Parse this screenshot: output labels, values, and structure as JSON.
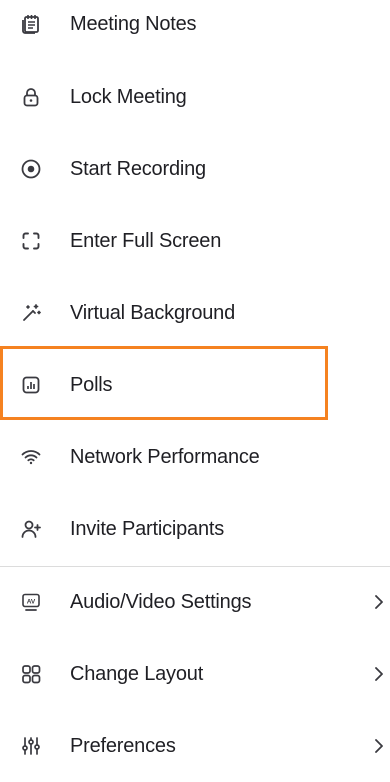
{
  "menu": {
    "items": [
      {
        "label": "Meeting Notes",
        "icon": "notes-icon"
      },
      {
        "label": "Lock Meeting",
        "icon": "lock-icon"
      },
      {
        "label": "Start Recording",
        "icon": "record-icon"
      },
      {
        "label": "Enter Full Screen",
        "icon": "fullscreen-icon"
      },
      {
        "label": "Virtual Background",
        "icon": "magic-wand-icon"
      },
      {
        "label": "Polls",
        "icon": "poll-icon",
        "highlighted": true
      },
      {
        "label": "Network Performance",
        "icon": "wifi-icon"
      },
      {
        "label": "Invite Participants",
        "icon": "add-user-icon"
      },
      {
        "label": "Audio/Video Settings",
        "icon": "av-settings-icon",
        "submenu": true
      },
      {
        "label": "Change Layout",
        "icon": "layout-grid-icon",
        "submenu": true
      },
      {
        "label": "Preferences",
        "icon": "sliders-icon",
        "submenu": true
      }
    ]
  },
  "colors": {
    "highlight_border": "#f58220",
    "text": "#1f1f24",
    "icon": "#3a3a40",
    "divider": "#dcdcdc"
  }
}
